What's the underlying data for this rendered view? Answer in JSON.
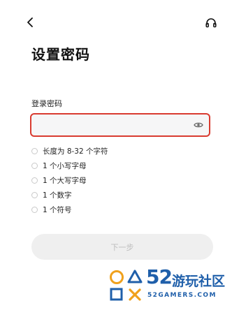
{
  "page": {
    "title": "设置密码"
  },
  "form": {
    "field_label": "登录密码",
    "password_value": "",
    "password_placeholder": ""
  },
  "rules": [
    "长度为 8-32 个字符",
    "1 个小写字母",
    "1 个大写字母",
    "1 个数字",
    "1 个符号"
  ],
  "actions": {
    "next_label": "下一步"
  },
  "icons": {
    "back": "back-chevron-icon",
    "support": "headset-icon",
    "visibility": "eye-icon"
  },
  "watermark": {
    "number": "52",
    "name": "游玩社区",
    "site": "52GAMERS.COM"
  },
  "colors": {
    "field_border": "#d93b30",
    "field_bg": "#f6f6f7",
    "button_bg": "#efefef",
    "button_text": "#bdbdbd",
    "watermark_blue": "#1f5faa"
  }
}
